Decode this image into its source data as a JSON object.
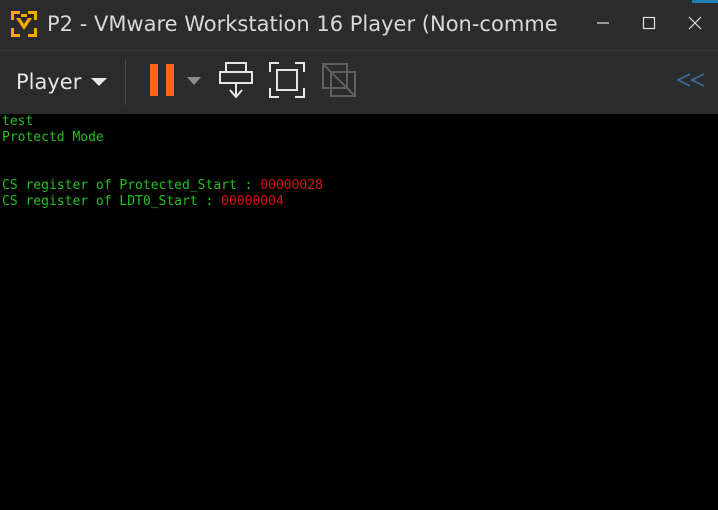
{
  "window": {
    "title": "P2 - VMware Workstation 16 Player (Non-comme",
    "controls": [
      "minimize-icon",
      "maximize-icon",
      "close-icon"
    ],
    "logo_icon": "vmware-logo-icon"
  },
  "toolbar": {
    "player_menu_label": "Player",
    "buttons": [
      {
        "name": "pause-button",
        "icon": "pause-icon",
        "color": "#f26722"
      },
      {
        "name": "power-options-dropdown",
        "icon": "chevron-down-icon"
      },
      {
        "name": "send-ctrl-alt-del-button",
        "icon": "send-keys-icon"
      },
      {
        "name": "full-screen-button",
        "icon": "fullscreen-icon"
      },
      {
        "name": "unity-button",
        "icon": "unity-icon",
        "state": "disabled"
      },
      {
        "name": "collapse-toolbar-button",
        "icon": "double-chevron-left-icon"
      }
    ]
  },
  "console": {
    "lines": [
      {
        "text": "test",
        "color": "#1fc11f"
      },
      {
        "text": "Protectd Mode",
        "color": "#1fc11f"
      },
      {
        "label": "CS register of Protected_Start : ",
        "value": "00000028",
        "label_color": "#1fc11f",
        "value_color": "#d01414"
      },
      {
        "label": "CS register of LDT0_Start : ",
        "value": "00000004",
        "label_color": "#1fc11f",
        "value_color": "#d01414"
      }
    ]
  },
  "colors": {
    "titlebar_bg": "#2b2b2b",
    "console_bg": "#000000",
    "accent_orange": "#f26722",
    "logo_yellow": "#f5a900"
  }
}
